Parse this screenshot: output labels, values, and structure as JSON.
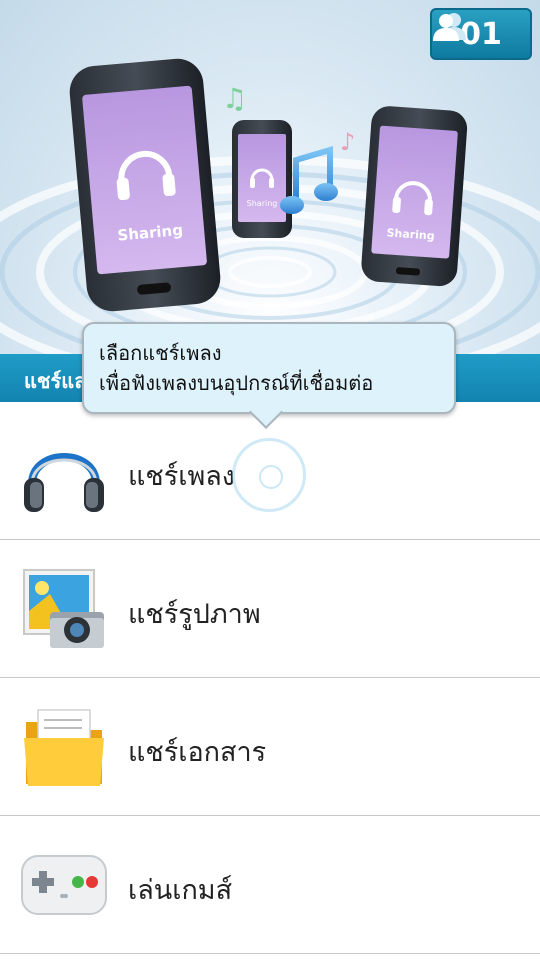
{
  "header": {
    "connected_count": "01",
    "section_title": "แชร์และ"
  },
  "hero": {
    "phone_screen_label": "Sharing"
  },
  "tooltip": {
    "line1": "เลือกแชร์เพลง",
    "line2": "เพื่อฟังเพลงบนอุปกรณ์ที่เชื่อมต่อ"
  },
  "items": [
    {
      "label": "แชร์เพลง",
      "icon": "headphones-icon"
    },
    {
      "label": "แชร์รูปภาพ",
      "icon": "photo-camera-icon"
    },
    {
      "label": "แชร์เอกสาร",
      "icon": "folder-icon"
    },
    {
      "label": "เล่นเกมส์",
      "icon": "gamepad-icon"
    }
  ],
  "colors": {
    "accent": "#1a8fbd",
    "tooltip_bg": "#def2fb",
    "phone_screen": "#c9a9e6"
  }
}
